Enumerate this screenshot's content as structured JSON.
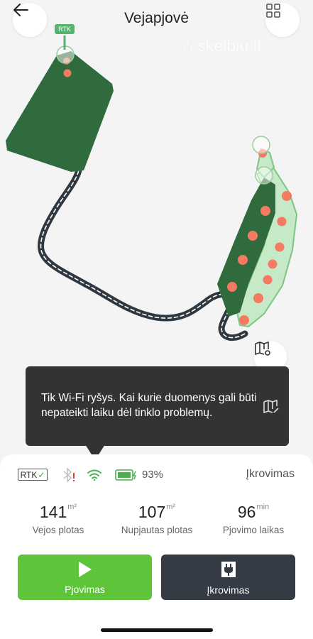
{
  "header": {
    "title": "Vejapjovė",
    "back_icon": "arrow-left-icon",
    "menu_icon": "grid-icon"
  },
  "watermark": {
    "text": "skelbiu.lt"
  },
  "map": {
    "rtk_station_label": "RTK",
    "map_settings_icon": "map-settings-icon"
  },
  "tooltip": {
    "text": "Tik Wi-Fi ryšys. Kai kurie duomenys gali būti nepateikti laiku dėl tinklo problemų.",
    "icon": "map-edit-icon"
  },
  "status_bar": {
    "rtk_label": "RTK",
    "battery_percent": "93%",
    "charging_status": "Įkrovimas"
  },
  "stats": [
    {
      "value": "141",
      "unit": "m²",
      "label": "Vejos plotas"
    },
    {
      "value": "107",
      "unit": "m²",
      "label": "Nupjautas plotas"
    },
    {
      "value": "96",
      "unit": "min",
      "label": "Pjovimo laikas"
    }
  ],
  "actions": {
    "mow_label": "Pjovimas",
    "charge_label": "Įkrovimas"
  },
  "colors": {
    "mow_green": "#5ec53a",
    "lawn_dark_green": "#2f6b3c",
    "lawn_light_green": "#c6e9c7",
    "charge_button": "#353b44",
    "tooltip_bg": "#333335",
    "waypoint": "#f47a62"
  }
}
